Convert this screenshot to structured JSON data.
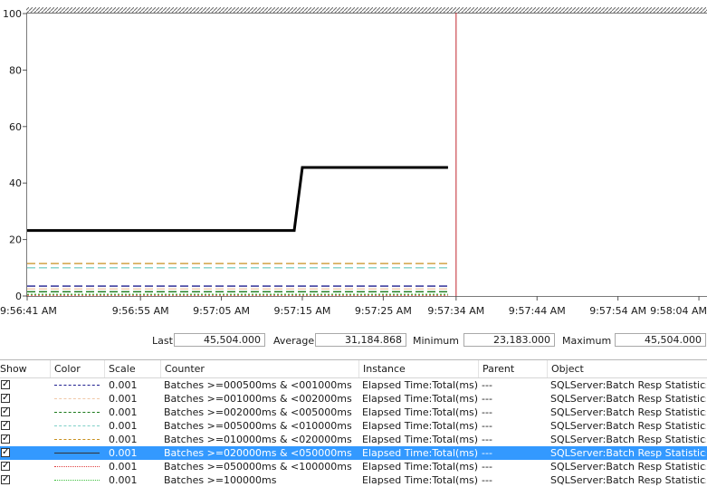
{
  "chart_data": {
    "type": "line",
    "ylim": [
      0,
      100
    ],
    "yticks": [
      0,
      20,
      40,
      60,
      80,
      100
    ],
    "xticks": [
      "9:56:41 AM",
      "9:56:55 AM",
      "9:57:05 AM",
      "9:57:15 AM",
      "9:57:25 AM",
      "9:57:34 AM",
      "9:57:44 AM",
      "9:57:54 AM",
      "9:58:04 AM"
    ],
    "xlim": [
      0,
      84
    ],
    "x_tick_positions": [
      0,
      14,
      24,
      34,
      44,
      53,
      63,
      73,
      83
    ],
    "current_time_marker": 53,
    "grid": false,
    "series": [
      {
        "name": "Batches >=000500ms & <001000ms",
        "color": "#1f1f8f",
        "style": "dash",
        "x": [
          0,
          52
        ],
        "values": [
          3.5,
          3.5
        ]
      },
      {
        "name": "Batches >=001000ms & <002000ms",
        "color": "#f0c8a8",
        "style": "dash",
        "x": [
          0,
          52
        ],
        "values": [
          2.5,
          2.5
        ]
      },
      {
        "name": "Batches >=002000ms & <005000ms",
        "color": "#1a7a1a",
        "style": "dash",
        "x": [
          0,
          52
        ],
        "values": [
          1.5,
          1.5
        ]
      },
      {
        "name": "Batches >=005000ms & <010000ms",
        "color": "#7fd0c8",
        "style": "dash",
        "x": [
          0,
          52
        ],
        "values": [
          10,
          10
        ]
      },
      {
        "name": "Batches >=010000ms & <020000ms",
        "color": "#c89020",
        "style": "dash",
        "x": [
          0,
          52
        ],
        "values": [
          11.5,
          11.5
        ]
      },
      {
        "name": "Batches >=020000ms & <050000ms",
        "color": "#000000",
        "style": "solid",
        "x": [
          0,
          33,
          34,
          52
        ],
        "values": [
          23.2,
          23.2,
          45.5,
          45.5
        ]
      },
      {
        "name": "Batches >=050000ms & <100000ms",
        "color": "#e04040",
        "style": "dot",
        "x": [
          0,
          52
        ],
        "values": [
          0.3,
          0.3
        ]
      },
      {
        "name": "Batches >=100000ms",
        "color": "#40c040",
        "style": "dot",
        "x": [
          0,
          52
        ],
        "values": [
          0.6,
          0.6
        ]
      }
    ]
  },
  "stats": {
    "last_label": "Last",
    "last": "45,504.000",
    "average_label": "Average",
    "average": "31,184.868",
    "minimum_label": "Minimum",
    "minimum": "23,183.000",
    "maximum_label": "Maximum",
    "maximum": "45,504.000"
  },
  "table": {
    "headers": [
      "Show",
      "Color",
      "Scale",
      "Counter",
      "Instance",
      "Parent",
      "Object"
    ],
    "rows": [
      {
        "show": true,
        "scale": "0.001",
        "counter": "Batches >=000500ms & <001000ms",
        "instance": "Elapsed Time:Total(ms)",
        "parent": "---",
        "object": "SQLServer:Batch Resp Statistics",
        "color": "#1f1f8f",
        "style": "dashed"
      },
      {
        "show": true,
        "scale": "0.001",
        "counter": "Batches >=001000ms & <002000ms",
        "instance": "Elapsed Time:Total(ms)",
        "parent": "---",
        "object": "SQLServer:Batch Resp Statistics",
        "color": "#f0c8a8",
        "style": "dashed"
      },
      {
        "show": true,
        "scale": "0.001",
        "counter": "Batches >=002000ms & <005000ms",
        "instance": "Elapsed Time:Total(ms)",
        "parent": "---",
        "object": "SQLServer:Batch Resp Statistics",
        "color": "#1a7a1a",
        "style": "dashed"
      },
      {
        "show": true,
        "scale": "0.001",
        "counter": "Batches >=005000ms & <010000ms",
        "instance": "Elapsed Time:Total(ms)",
        "parent": "---",
        "object": "SQLServer:Batch Resp Statistics",
        "color": "#7fd0c8",
        "style": "dashed"
      },
      {
        "show": true,
        "scale": "0.001",
        "counter": "Batches >=010000ms & <020000ms",
        "instance": "Elapsed Time:Total(ms)",
        "parent": "---",
        "object": "SQLServer:Batch Resp Statistics",
        "color": "#c89020",
        "style": "dashed"
      },
      {
        "show": true,
        "scale": "0.001",
        "counter": "Batches >=020000ms & <050000ms",
        "instance": "Elapsed Time:Total(ms)",
        "parent": "---",
        "object": "SQLServer:Batch Resp Statistics",
        "color": "#333333",
        "style": "solid",
        "selected": true
      },
      {
        "show": true,
        "scale": "0.001",
        "counter": "Batches >=050000ms & <100000ms",
        "instance": "Elapsed Time:Total(ms)",
        "parent": "---",
        "object": "SQLServer:Batch Resp Statistics",
        "color": "#e04040",
        "style": "dotted"
      },
      {
        "show": true,
        "scale": "0.001",
        "counter": "Batches >=100000ms",
        "instance": "Elapsed Time:Total(ms)",
        "parent": "---",
        "object": "SQLServer:Batch Resp Statistics",
        "color": "#40c040",
        "style": "dotted"
      }
    ]
  }
}
